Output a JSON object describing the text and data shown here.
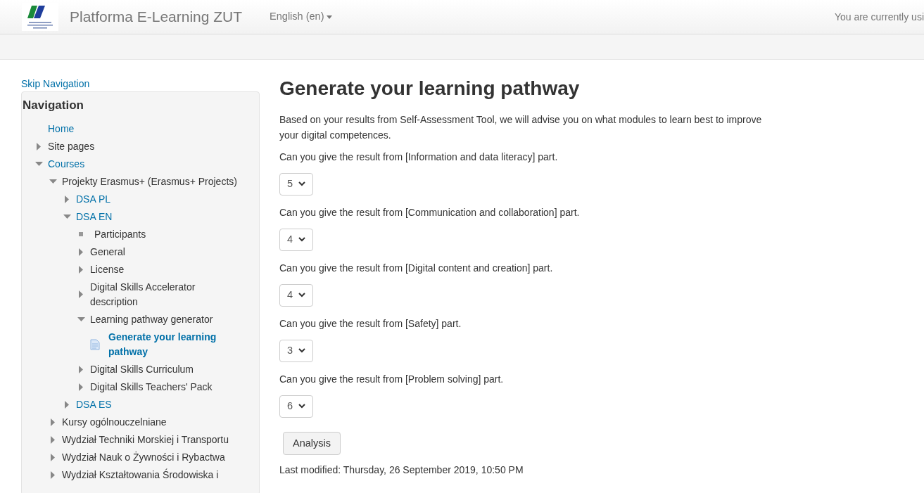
{
  "navbar": {
    "brand": "Platforma E-Learning ZUT",
    "language": "English (en)",
    "login_info": "You are currently usi"
  },
  "skip_link": "Skip Navigation",
  "navigation": {
    "title": "Navigation",
    "items": [
      {
        "label": "Home",
        "link": true
      },
      {
        "label": "Site pages",
        "link": false,
        "expanded": false
      },
      {
        "label": "Courses",
        "link": true,
        "expanded": true,
        "children": [
          {
            "label": "Projekty Erasmus+ (Erasmus+ Projects)",
            "link": false,
            "expanded": true,
            "children": [
              {
                "label": "DSA PL",
                "link": true,
                "expanded": false
              },
              {
                "label": "DSA EN",
                "link": true,
                "expanded": true,
                "children": [
                  {
                    "label": "Participants",
                    "link": false,
                    "kind": "bullet"
                  },
                  {
                    "label": "General",
                    "link": false,
                    "expanded": false
                  },
                  {
                    "label": "License",
                    "link": false,
                    "expanded": false
                  },
                  {
                    "label": "Digital Skills Accelerator description",
                    "link": false,
                    "expanded": false
                  },
                  {
                    "label": "Learning pathway generator",
                    "link": false,
                    "expanded": true,
                    "children": [
                      {
                        "label": "Generate your learning pathway",
                        "link": true,
                        "kind": "page",
                        "selected": true
                      }
                    ]
                  },
                  {
                    "label": "Digital Skills Curriculum",
                    "link": false,
                    "expanded": false
                  },
                  {
                    "label": "Digital Skills Teachers' Pack",
                    "link": false,
                    "expanded": false
                  }
                ]
              },
              {
                "label": "DSA ES",
                "link": true,
                "expanded": false
              }
            ]
          },
          {
            "label": "Kursy ogólnouczelniane",
            "link": false,
            "expanded": false
          },
          {
            "label": "Wydział Techniki Morskiej i Transportu",
            "link": false,
            "expanded": false
          },
          {
            "label": "Wydział Nauk o Żywności i Rybactwa",
            "link": false,
            "expanded": false
          },
          {
            "label": "Wydział Kształtowania Środowiska i",
            "link": false,
            "expanded": false
          }
        ]
      }
    ]
  },
  "main": {
    "title": "Generate your learning pathway",
    "intro": "Based on your results from Self-Assessment Tool, we will advise you on what modules to learn best to improve your digital competences.",
    "questions": [
      {
        "label": "Can you give the result from [Information and data literacy] part.",
        "value": "5"
      },
      {
        "label": "Can you give the result from [Communication and collaboration] part.",
        "value": "4"
      },
      {
        "label": "Can you give the result from [Digital content and creation] part.",
        "value": "4"
      },
      {
        "label": "Can you give the result from [Safety] part.",
        "value": "3"
      },
      {
        "label": "Can you give the result from [Problem solving] part.",
        "value": "6"
      }
    ],
    "button": "Analysis",
    "last_modified": "Last modified: Thursday, 26 September 2019, 10:50 PM"
  }
}
